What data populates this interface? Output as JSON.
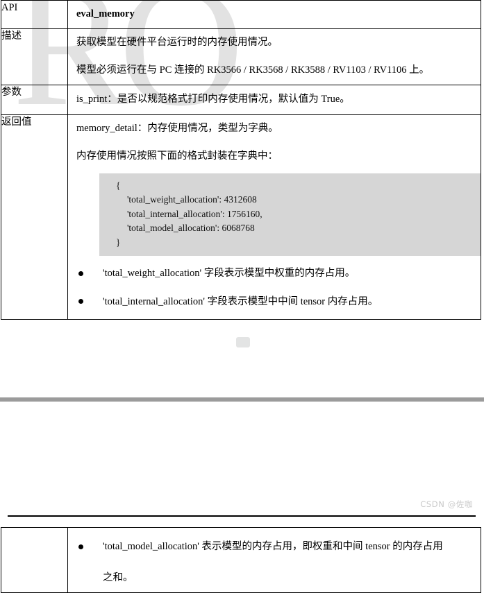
{
  "watermark": {
    "background_text": "RO",
    "footer_text": "CSDN @佐咖"
  },
  "api_table": {
    "rows": [
      {
        "label": "API",
        "value": "eval_memory"
      },
      {
        "label": "描述",
        "paragraphs": [
          "获取模型在硬件平台运行时的内存使用情况。",
          "模型必须运行在与 PC 连接的 RK3566 / RK3568 / RK3588 / RV1103 / RV1106 上。"
        ]
      },
      {
        "label": "参数",
        "paragraphs": [
          "is_print：是否以规范格式打印内存使用情况，默认值为 True。"
        ]
      },
      {
        "label": "返回值",
        "paragraphs": [
          "memory_detail：内存使用情况，类型为字典。",
          "内存使用情况按照下面的格式封装在字典中："
        ],
        "code_block": [
          "{",
          "'total_weight_allocation': 4312608",
          "'total_internal_allocation': 1756160,",
          "'total_model_allocation': 6068768",
          "}"
        ],
        "bullets": [
          "'total_weight_allocation' 字段表示模型中权重的内存占用。",
          "'total_internal_allocation' 字段表示模型中中间 tensor 内存占用。"
        ]
      }
    ]
  },
  "bottom_table": {
    "bullet_line1": "'total_model_allocation' 表示模型的内存占用，即权重和中间 tensor 的内存占用",
    "bullet_line2": "之和。"
  }
}
